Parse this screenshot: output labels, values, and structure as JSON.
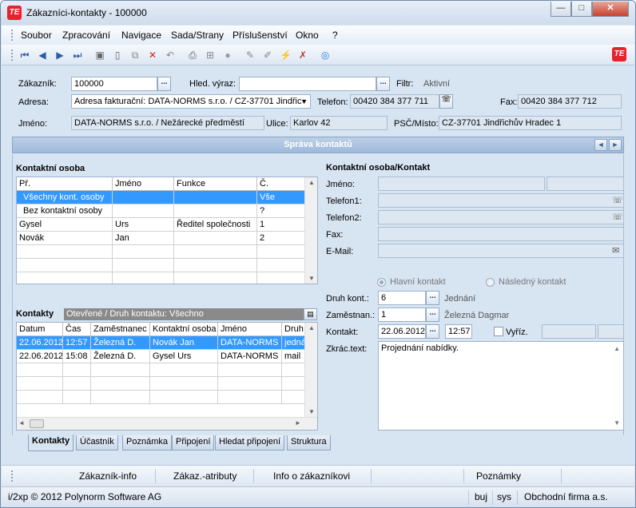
{
  "window": {
    "title": "Zákazníci-kontakty - 100000",
    "app_icon": "TE",
    "minimize": "—",
    "maximize": "□",
    "close": "✕"
  },
  "menu": [
    "Soubor",
    "Zpracování",
    "Navigace",
    "Sada/Strany",
    "Příslušenství",
    "Okno",
    "?"
  ],
  "header": {
    "customer_label": "Zákazník:",
    "customer_value": "100000",
    "search_label": "Hled. výraz:",
    "search_value": "",
    "filter_label": "Filtr:",
    "filter_value": "Aktivní",
    "address_label": "Adresa:",
    "address_value": "Adresa fakturační: DATA-NORMS s.r.o. / CZ-37701 Jindřic",
    "phone_label": "Telefon:",
    "phone_value": "00420 384 377 711",
    "fax_label": "Fax:",
    "fax_value": "00420 384 377 712",
    "name_label": "Jméno:",
    "name_value": "DATA-NORMS s.r.o. / Nežárecké předměstí",
    "street_label": "Ulice:",
    "street_value": "Karlov 42",
    "zip_label": "PSČ/Místo:",
    "zip_value": "CZ-37701 Jindřichův Hradec 1",
    "dots": "..."
  },
  "panel": {
    "title": "Správa kontaktů",
    "prev": "◄",
    "next": "►"
  },
  "contacts_person": {
    "title": "Kontaktní osoba",
    "columns": [
      "Př.",
      "Jméno",
      "Funkce",
      "Č."
    ],
    "rows": [
      [
        "Všechny kont. osoby",
        "",
        "",
        "Vše"
      ],
      [
        "Bez kontaktní osoby",
        "",
        "",
        "?"
      ],
      [
        "Gysel",
        "Urs",
        "Ředitel společnosti",
        "1"
      ],
      [
        "Novák",
        "Jan",
        "",
        "2"
      ]
    ]
  },
  "contacts": {
    "title": "Kontakty",
    "filter": "Otevřené / Druh kontaktu: Všechno",
    "columns": [
      "Datum",
      "Čas",
      "Zaměstnanec",
      "Kontaktní osoba",
      "Jméno",
      "Druh"
    ],
    "rows": [
      [
        "22.06.2012",
        "12:57",
        "Železná D.",
        "Novák Jan",
        "DATA-NORMS",
        "jedná"
      ],
      [
        "22.06.2012",
        "15:08",
        "Železná D.",
        "Gysel Urs",
        "DATA-NORMS",
        "mail"
      ]
    ]
  },
  "detail": {
    "title": "Kontaktní osoba/Kontakt",
    "name_label": "Jméno:",
    "phone1_label": "Telefon1:",
    "phone2_label": "Telefon2:",
    "fax_label": "Fax:",
    "email_label": "E-Mail:",
    "main_contact": "Hlavní kontakt",
    "next_contact": "Následný kontakt",
    "kind_label": "Druh kont.:",
    "kind_value": "6",
    "kind_text": "Jednání",
    "employee_label": "Zaměstnan.:",
    "employee_value": "1",
    "employee_text": "Železná Dagmar",
    "contact_label": "Kontakt:",
    "contact_date": "22.06.2012",
    "contact_time": "12:57",
    "done_label": "Vyříz.",
    "short_label": "Zkrác.text:",
    "short_value": "Projednání nabídky."
  },
  "tabs": [
    "Kontakty",
    "Účastník",
    "Poznámka",
    "Připojení",
    "Hledat připojení",
    "Struktura"
  ],
  "links": [
    "Zákazník-info",
    "Zákaz.-atributy",
    "Info o zákazníkovi",
    "Poznámky"
  ],
  "status": {
    "copyright": "i/2xp © 2012 Polynorm Software AG",
    "user": "buj",
    "db": "sys",
    "company": "Obchodní firma a.s."
  }
}
